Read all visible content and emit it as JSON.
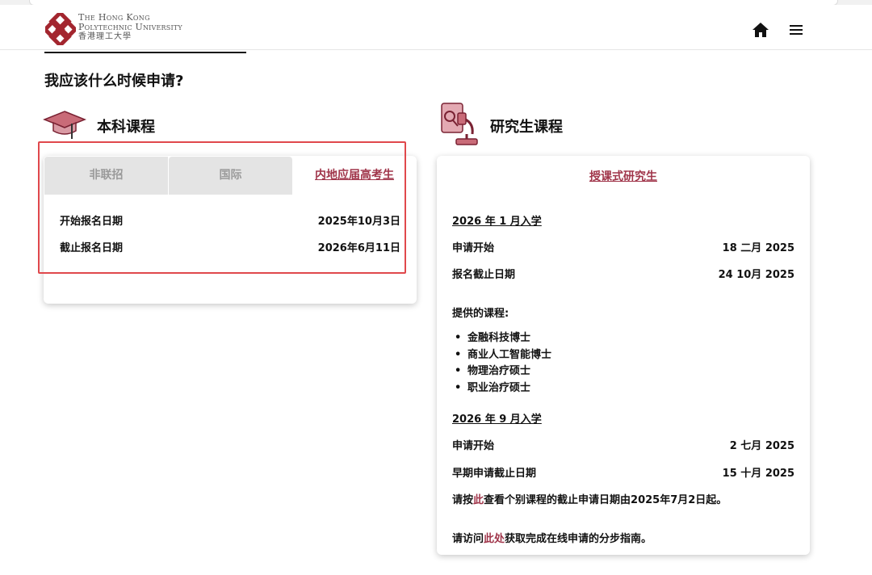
{
  "header": {
    "logo_line1": "The Hong Kong",
    "logo_line2": "Polytechnic University",
    "logo_line3": "香港理工大學"
  },
  "page": {
    "question_title": "我应该什么时候申请?"
  },
  "undergrad": {
    "title": "本科课程",
    "tabs": [
      {
        "label": "非联招",
        "state": "inactive"
      },
      {
        "label": "国际",
        "state": "inactive"
      },
      {
        "label": "内地应届高考生",
        "state": "active"
      }
    ],
    "rows": [
      {
        "label": "开始报名日期",
        "value": "2025年10月3日"
      },
      {
        "label": "截止报名日期",
        "value": "2026年6月11日"
      }
    ]
  },
  "postgrad": {
    "title": "研究生课程",
    "tab": "授课式研究生",
    "jan_intake": {
      "heading": "2026 年 1 月入学",
      "rows": [
        {
          "label": "申请开始",
          "value": "18 二月 2025"
        },
        {
          "label": "报名截止日期",
          "value": "24 10月 2025"
        }
      ],
      "programmes_label": "提供的课程:",
      "programmes": [
        "金融科技博士",
        "商业人工智能博士",
        "物理治疗硕士",
        "职业治疗硕士"
      ]
    },
    "sep_intake": {
      "heading": "2026 年 9 月入学",
      "rows": [
        {
          "label": "申请开始",
          "value": "2 七月 2025"
        },
        {
          "label": "早期申请截止日期",
          "value": "15 十月 2025"
        }
      ]
    },
    "note1": {
      "pre": "请按",
      "link": "此",
      "post": "查看个别课程的截止申请日期由2025年7月2日起。"
    },
    "note2": {
      "pre": "请访问",
      "link": "此处",
      "post": "获取完成在线申请的分步指南。"
    }
  },
  "colors": {
    "accent": "#a0354a",
    "highlight_border": "#e0484c"
  }
}
